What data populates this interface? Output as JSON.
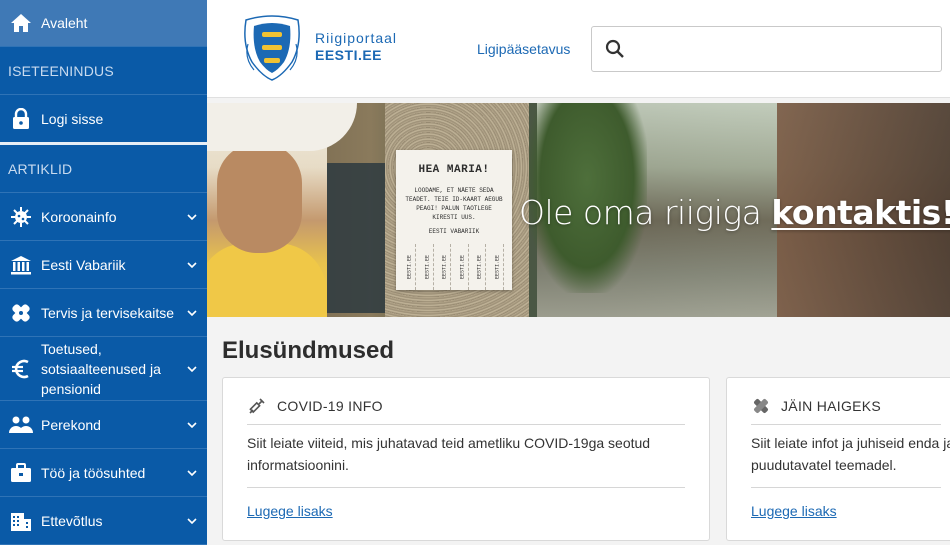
{
  "sidebar": {
    "home_label": "Avaleht",
    "section_self_service": "ISETEENINDUS",
    "login_label": "Logi sisse",
    "section_articles": "ARTIKLID",
    "items": [
      {
        "label": "Koroonainfo",
        "icon": "virus-icon"
      },
      {
        "label": "Eesti Vabariik",
        "icon": "institution-icon"
      },
      {
        "label": "Tervis ja tervisekaitse",
        "icon": "bandage-icon"
      },
      {
        "label_lines": [
          "Toetused,",
          "sotsiaalteenused ja",
          "pensionid"
        ],
        "icon": "euro-icon"
      },
      {
        "label": "Perekond",
        "icon": "family-icon"
      },
      {
        "label": "Töö ja töösuhted",
        "icon": "briefcase-icon"
      },
      {
        "label": "Ettevõtlus",
        "icon": "building-icon"
      }
    ]
  },
  "header": {
    "brand_line1": "Riigiportaal",
    "brand_line2": "EESTI.EE",
    "accessibility_label": "Ligipääsetavus",
    "search_placeholder": "",
    "search_value": ""
  },
  "hero": {
    "note_title": "HEA MARIA!",
    "note_body": "LOODAME, ET NÄETE SEDA TEADET. TEIE ID-KAART AEGUB PEAGI! PALUN TAOTLEGE KIRESTI UUS.",
    "note_sign": "EESTI VABARIIK",
    "note_strip": "EESTI.EE",
    "text_plain": "Ole oma riigiga ",
    "text_strong": "kontaktis!"
  },
  "main": {
    "title": "Elusündmused",
    "cards": [
      {
        "title": "COVID-19 INFO",
        "icon": "syringe-icon",
        "text_lines": [
          "Siit leiate viiteid, mis juhatavad teid ametliku COVID-19ga seotud",
          "informatsioonini."
        ],
        "link": "Lugege lisaks"
      },
      {
        "title": "JÄIN HAIGEKS",
        "icon": "bandage-icon",
        "text_lines": [
          "Siit leiate infot ja juhiseid enda ja",
          "puudutavatel teemadel."
        ],
        "link": "Lugege lisaks"
      }
    ]
  },
  "colors": {
    "sidebar_bg": "#0a5aa7",
    "brand_blue": "#1c69b4",
    "page_bg": "#f3f3f3"
  }
}
